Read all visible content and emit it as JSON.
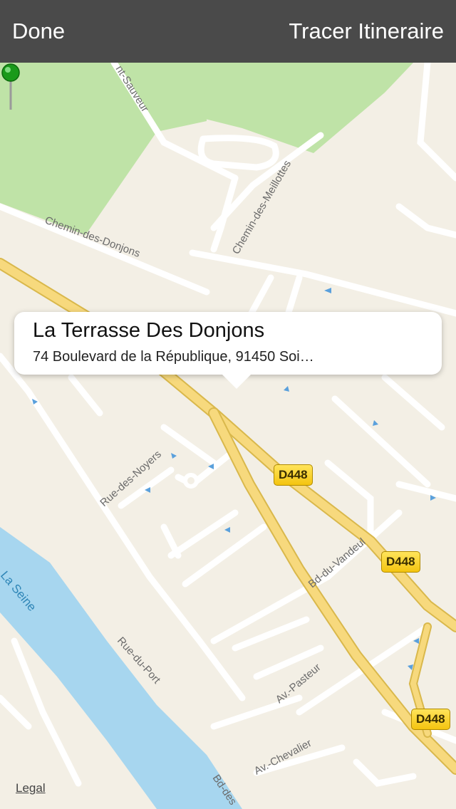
{
  "header": {
    "left_button": "Done",
    "right_button": "Tracer Itineraire"
  },
  "callout": {
    "title": "La Terrasse Des Donjons",
    "address": "74 Boulevard de la République, 91450 Soi…"
  },
  "streets": {
    "chemin_donjons": "Chemin-des-Donjons",
    "chemin_meillottes": "Chemin-des-Meillottes",
    "saint_sauveur": "nt-Sauveur",
    "rue_noyers": "Rue-des-Noyers",
    "bd_vandeul": "Bd-du-Vandeul",
    "rue_port": "Rue-du-Port",
    "av_pasteur": "Av.-Pasteur",
    "av_chevalier": "Av.-Chevalier",
    "bd_bottom": "Bd-des",
    "river": "La Seine"
  },
  "road_shields": [
    "D448",
    "D448",
    "D448"
  ],
  "legal": "Legal",
  "colors": {
    "header_bg": "#4a4a4a",
    "land": "#f3efe5",
    "park": "#bfe3a7",
    "water": "#a7d6ef",
    "major_road": "#f5d57a",
    "pin": "#1a9a1a"
  },
  "icons": {
    "pin": "green-map-pin-icon"
  }
}
